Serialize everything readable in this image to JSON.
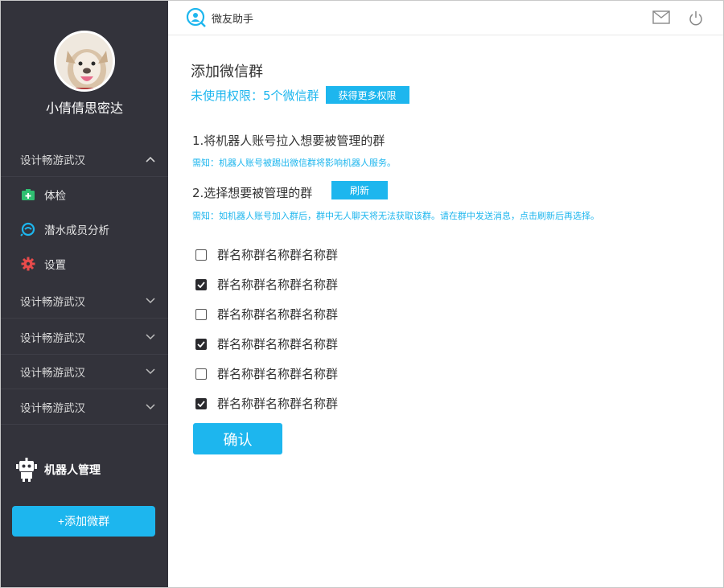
{
  "app": {
    "name": "微友助手"
  },
  "user": {
    "name": "小倩倩思密达"
  },
  "sidebar": {
    "expanded_group": {
      "label": "设计畅游武汉",
      "items": [
        {
          "label": "体检",
          "icon": "medkit-icon",
          "color": "#2fbf71"
        },
        {
          "label": "潜水成员分析",
          "icon": "chat-analysis-icon",
          "color": "#1db6ee"
        },
        {
          "label": "设置",
          "icon": "gear-icon",
          "color": "#e94b4b"
        }
      ]
    },
    "collapsed_groups": [
      {
        "label": "设计畅游武汉"
      },
      {
        "label": "设计畅游武汉"
      },
      {
        "label": "设计畅游武汉"
      },
      {
        "label": "设计畅游武汉"
      }
    ],
    "robot_label": "机器人管理",
    "add_button": "+添加微群"
  },
  "header": {
    "mail_icon": "mail-icon",
    "power_icon": "power-icon"
  },
  "main": {
    "title": "添加微信群",
    "quota_text": "未使用权限：5个微信群",
    "more_button": "获得更多权限",
    "step1": "1.将机器人账号拉入想要被管理的群",
    "note1": "需知：机器人账号被踢出微信群将影响机器人服务。",
    "step2": "2.选择想要被管理的群",
    "refresh_button": "刷新",
    "note2": "需知：如机器人账号加入群后，群中无人聊天将无法获取该群。请在群中发送消息，点击刷新后再选择。",
    "groups": [
      {
        "name": "群名称群名称群名称群",
        "checked": false
      },
      {
        "name": "群名称群名称群名称群",
        "checked": true
      },
      {
        "name": "群名称群名称群名称群",
        "checked": false
      },
      {
        "name": "群名称群名称群名称群",
        "checked": true
      },
      {
        "name": "群名称群名称群名称群",
        "checked": false
      },
      {
        "name": "群名称群名称群名称群",
        "checked": true
      }
    ],
    "confirm_button": "确认"
  },
  "colors": {
    "accent": "#1db6ee",
    "sidebar_bg": "#33333b"
  }
}
